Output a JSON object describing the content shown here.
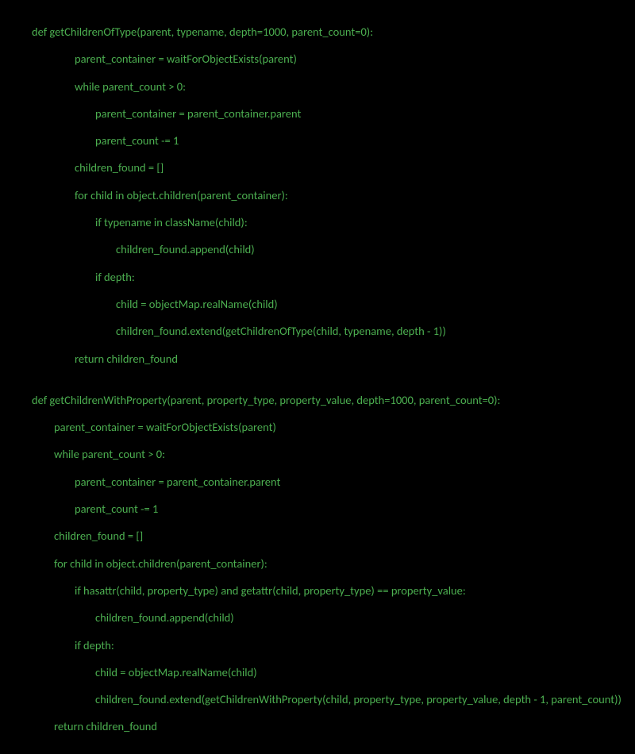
{
  "code": {
    "line1": "def getChildrenOfType(parent, typename, depth=1000, parent_count=0):",
    "line2": "parent_container = waitForObjectExists(parent)",
    "line3": "while parent_count > 0:",
    "line4": "parent_container = parent_container.parent",
    "line5": "parent_count -= 1",
    "line6": "children_found = []",
    "line7": "for child in object.children(parent_container):",
    "line8": "if typename in className(child):",
    "line9": "children_found.append(child)",
    "line10": "if depth:",
    "line11": "child = objectMap.realName(child)",
    "line12": "children_found.extend(getChildrenOfType(child, typename, depth - 1))",
    "line13": "return children_found",
    "line14": "def getChildrenWithProperty(parent, property_type, property_value, depth=1000, parent_count=0):",
    "line15": "parent_container = waitForObjectExists(parent)",
    "line16": "while parent_count > 0:",
    "line17": "parent_container = parent_container.parent",
    "line18": "parent_count -= 1",
    "line19": "children_found = []",
    "line20": "for child in object.children(parent_container):",
    "line21": "if hasattr(child, property_type) and getattr(child, property_type) == property_value:",
    "line22": "children_found.append(child)",
    "line23": "if depth:",
    "line24": "child = objectMap.realName(child)",
    "line25": "children_found.extend(getChildrenWithProperty(child, property_type, property_value, depth - 1, parent_count))",
    "line26": "return children_found"
  }
}
